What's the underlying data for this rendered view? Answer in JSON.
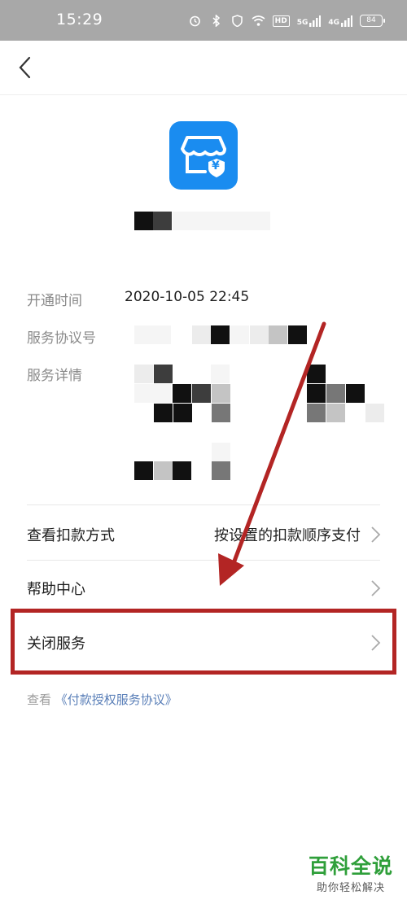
{
  "status_bar": {
    "time": "15:29",
    "network_5g": "5G",
    "network_4g": "4G",
    "hd": "HD",
    "battery": "84"
  },
  "navbar": {
    "back_icon": "chevron-left-icon"
  },
  "app": {
    "logo_icon": "store-yuan-icon",
    "yuan_symbol": "¥"
  },
  "info": {
    "open_time_label": "开通时间",
    "open_time_value": "2020-10-05 22:45",
    "agreement_no_label": "服务协议号",
    "details_label": "服务详情"
  },
  "menu": {
    "payment_method_label": "查看扣款方式",
    "payment_method_value": "按设置的扣款顺序支付",
    "help_label": "帮助中心",
    "close_service_label": "关闭服务"
  },
  "footer": {
    "prefix": "查看",
    "agreement_link": "《付款授权服务协议》"
  },
  "watermark": {
    "title": "百科全说",
    "subtitle": "助你轻松解决"
  },
  "colors": {
    "accent_blue": "#1a8cf0",
    "highlight_red": "#b32524",
    "arrow_red": "#b32524",
    "watermark_green": "#2f9f3a",
    "link_blue": "#5a7fb8"
  }
}
